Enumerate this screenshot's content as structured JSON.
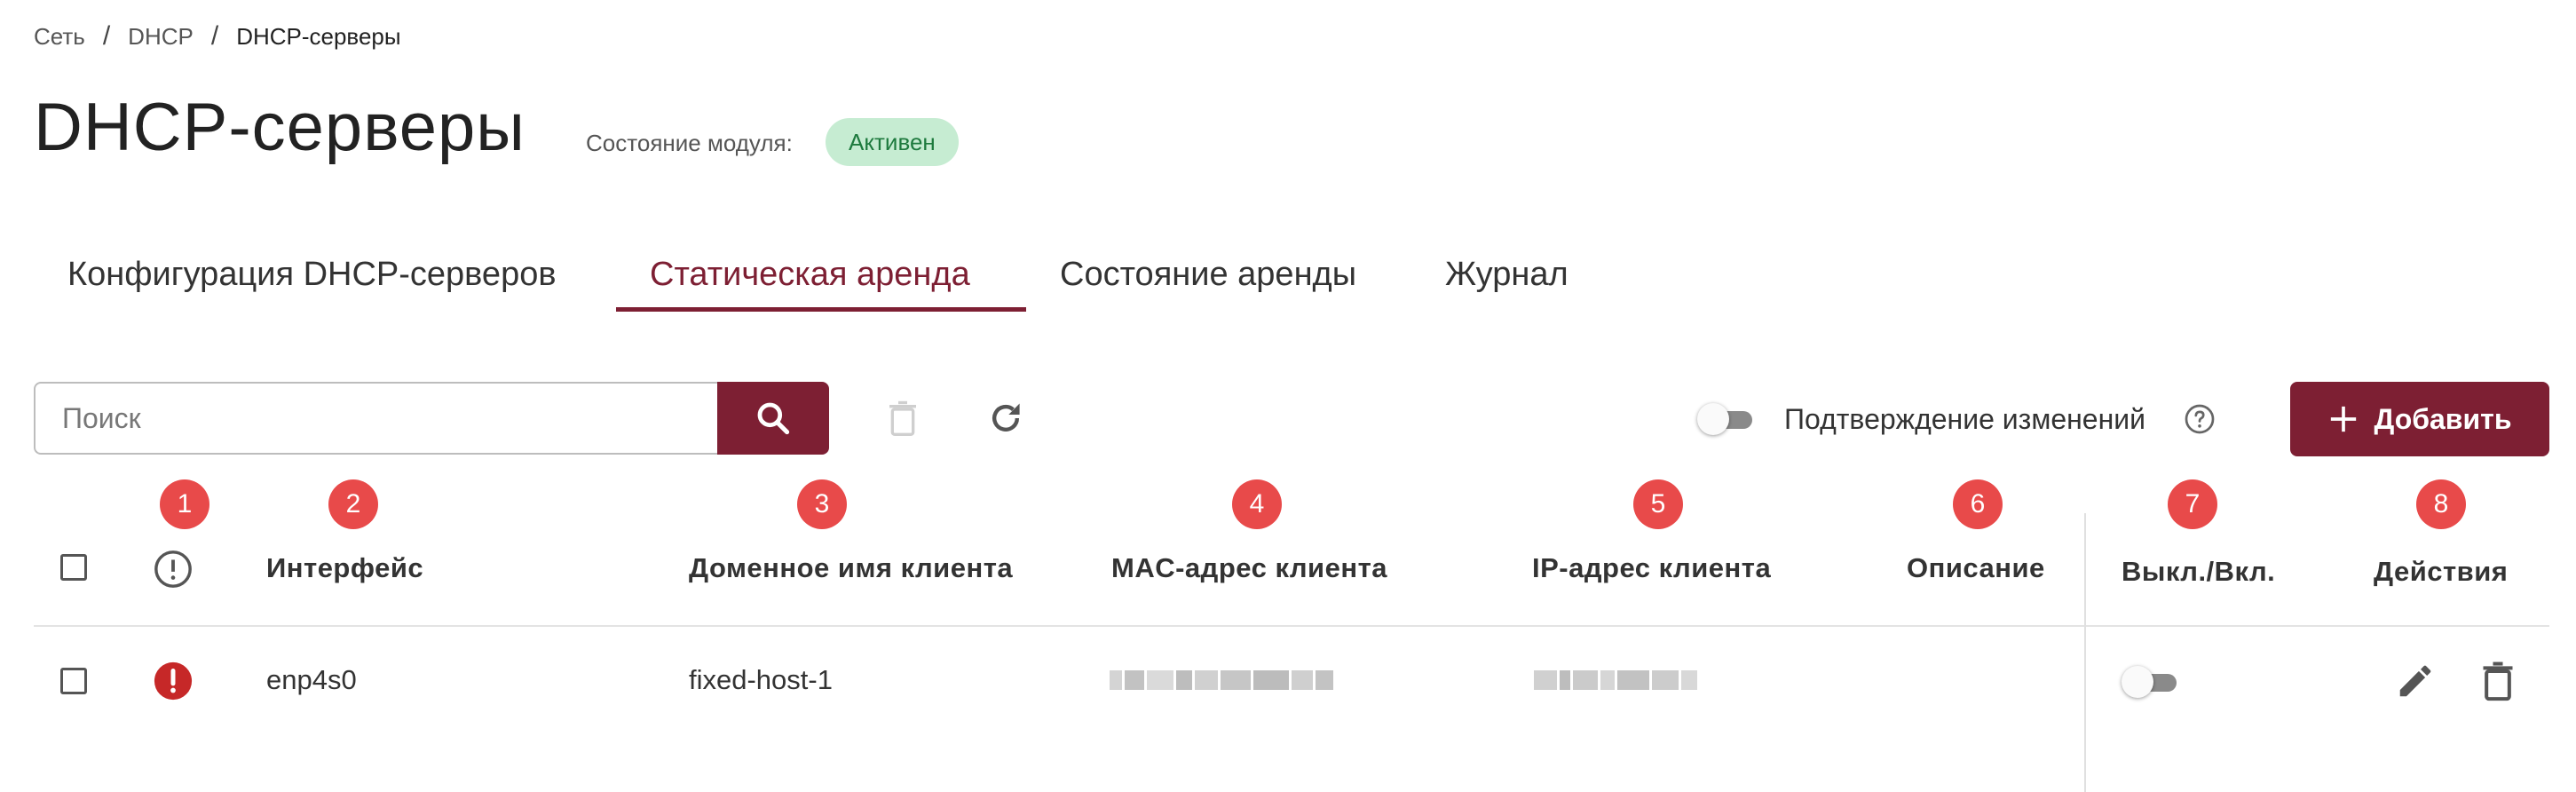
{
  "breadcrumb": [
    "Сеть",
    "DHCP",
    "DHCP-серверы"
  ],
  "page_title": "DHCP-серверы",
  "module_state": {
    "label": "Состояние модуля:",
    "status": "Активен"
  },
  "tabs": [
    {
      "label": "Конфигурация DHCP-серверов",
      "active": false
    },
    {
      "label": "Статическая аренда",
      "active": true
    },
    {
      "label": "Состояние аренды",
      "active": false
    },
    {
      "label": "Журнал",
      "active": false
    }
  ],
  "search": {
    "placeholder": "Поиск",
    "value": ""
  },
  "confirm_changes": {
    "label": "Подтверждение изменений",
    "enabled": false
  },
  "add_button": {
    "label": "Добавить"
  },
  "markers": [
    "1",
    "2",
    "3",
    "4",
    "5",
    "6",
    "7",
    "8"
  ],
  "table": {
    "columns": [
      "Интерфейс",
      "Доменное имя клиента",
      "MAC-адрес клиента",
      "IP-адрес клиента",
      "Описание",
      "Выкл./Вкл.",
      "Действия"
    ],
    "rows": [
      {
        "interface": "enp4s0",
        "domain": "fixed-host-1",
        "mac": "",
        "ip": "",
        "description": "",
        "enabled": false,
        "has_error": true
      }
    ]
  },
  "colors": {
    "accent": "#7d1f33",
    "marker": "#e84a4a",
    "badge_bg": "#c6ecd2",
    "badge_text": "#1e7a3e",
    "error": "#c62828"
  },
  "icons": [
    "search-icon",
    "delete-icon",
    "refresh-icon",
    "help-icon",
    "plus-icon",
    "warning-icon",
    "error-icon",
    "edit-icon",
    "trash-icon"
  ]
}
